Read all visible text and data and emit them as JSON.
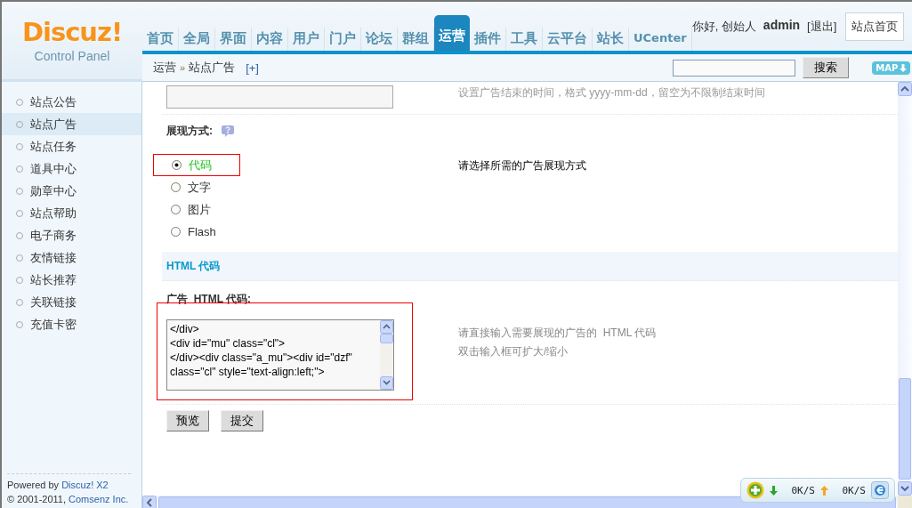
{
  "logo": {
    "name": "Discuz!",
    "subtitle": "Control Panel"
  },
  "nav": [
    {
      "label": "首页",
      "selected": false
    },
    {
      "label": "全局",
      "selected": false
    },
    {
      "label": "界面",
      "selected": false
    },
    {
      "label": "内容",
      "selected": false
    },
    {
      "label": "用户",
      "selected": false
    },
    {
      "label": "门户",
      "selected": false
    },
    {
      "label": "论坛",
      "selected": false
    },
    {
      "label": "群组",
      "selected": false
    },
    {
      "label": "运营",
      "selected": true
    },
    {
      "label": "插件",
      "selected": false
    },
    {
      "label": "工具",
      "selected": false
    },
    {
      "label": "云平台",
      "selected": false
    },
    {
      "label": "站长",
      "selected": false
    },
    {
      "label": "UCenter",
      "selected": false
    }
  ],
  "user": {
    "greeting": "你好, 创始人",
    "name": "admin",
    "logout": "[退出]",
    "home_button": "站点首页"
  },
  "breadcrumb": {
    "items": [
      "运营",
      "站点广告"
    ],
    "separator": "»",
    "add": "[+]"
  },
  "search": {
    "button": "搜索"
  },
  "map_button": "MAP",
  "sidebar": {
    "items": [
      {
        "label": "站点公告",
        "selected": false
      },
      {
        "label": "站点广告",
        "selected": true
      },
      {
        "label": "站点任务",
        "selected": false
      },
      {
        "label": "道具中心",
        "selected": false
      },
      {
        "label": "勋章中心",
        "selected": false
      },
      {
        "label": "站点帮助",
        "selected": false
      },
      {
        "label": "电子商务",
        "selected": false
      },
      {
        "label": "友情链接",
        "selected": false
      },
      {
        "label": "站长推荐",
        "selected": false
      },
      {
        "label": "关联链接",
        "selected": false
      },
      {
        "label": "充值卡密",
        "selected": false
      }
    ],
    "footer": {
      "powered": "Powered by ",
      "product": "Discuz! X2",
      "copyright": "© 2001-2011, ",
      "company": "Comsenz Inc."
    }
  },
  "form": {
    "end_time_hint": "设置广告结束的时间，格式 yyyy-mm-dd，留空为不限制结束时间",
    "style_label": "展现方式:",
    "style_options": [
      {
        "label": "代码",
        "selected": true
      },
      {
        "label": "文字",
        "selected": false
      },
      {
        "label": "图片",
        "selected": false
      },
      {
        "label": "Flash",
        "selected": false
      }
    ],
    "style_hint": "请选择所需的广告展现方式",
    "section_title": "HTML 代码",
    "code_label": "广告  HTML 代码:",
    "code_value": "</div>\n<div id=\"mu\" class=\"cl\">\n</div><div class=\"a_mu\"><div id=\"dzf\" class=\"cl\" style=\"text-align:left;\">",
    "code_hints": [
      "请直接输入需要展现的广告的  HTML 代码",
      "双击输入框可扩大/缩小"
    ],
    "buttons": [
      "预览",
      "提交"
    ]
  },
  "speed_widget": {
    "download": "0K/S",
    "upload": "0K/S"
  }
}
